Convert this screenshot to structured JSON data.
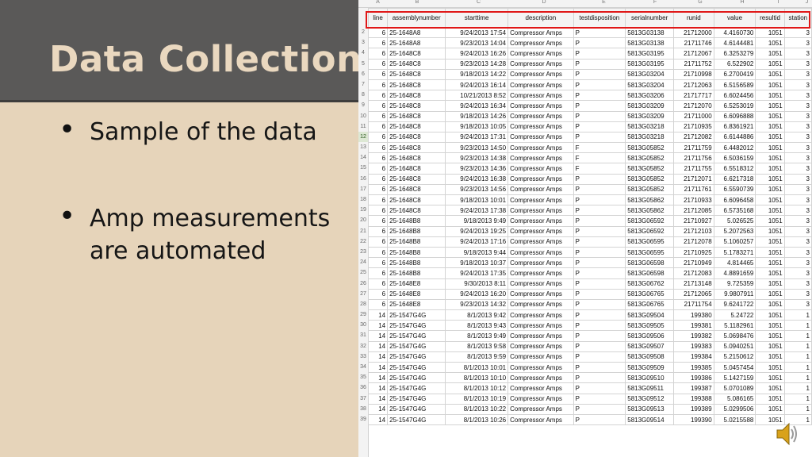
{
  "slide": {
    "title": "Data Collection",
    "bullets": [
      "Sample of the data",
      "Amp measurements are automated"
    ]
  },
  "sheet": {
    "column_letters": [
      "A",
      "B",
      "C",
      "D",
      "E",
      "F",
      "G",
      "H",
      "I",
      "J"
    ],
    "headers": [
      "line",
      "assemblynumber",
      "starttime",
      "description",
      "testdisposition",
      "serialnumber",
      "runid",
      "value",
      "resultid",
      "station"
    ],
    "row_numbers": [
      "2",
      "3",
      "4",
      "5",
      "6",
      "7",
      "8",
      "9",
      "10",
      "11",
      "12",
      "13",
      "14",
      "15",
      "16",
      "17",
      "18",
      "19",
      "20",
      "21",
      "22",
      "23",
      "24",
      "25",
      "26",
      "27",
      "28",
      "29",
      "30",
      "31",
      "32",
      "33",
      "34",
      "35",
      "36",
      "37",
      "38",
      "39"
    ],
    "selected_row_number": "12",
    "rows": [
      [
        "6",
        "25-1648A8",
        "9/24/2013 17:54",
        "Compressor Amps",
        "P",
        "5813G03138",
        "21712000",
        "4.4160730",
        "1051",
        "3"
      ],
      [
        "6",
        "25-1648A8",
        "9/23/2013 14:04",
        "Compressor Amps",
        "P",
        "5813G03138",
        "21711746",
        "4.6144481",
        "1051",
        "3"
      ],
      [
        "6",
        "25-1648C8",
        "9/24/2013 16:26",
        "Compressor Amps",
        "P",
        "5813G03195",
        "21712067",
        "6.3253279",
        "1051",
        "3"
      ],
      [
        "6",
        "25-1648C8",
        "9/23/2013 14:28",
        "Compressor Amps",
        "P",
        "5813G03195",
        "21711752",
        "6.522902",
        "1051",
        "3"
      ],
      [
        "6",
        "25-1648C8",
        "9/18/2013 14:22",
        "Compressor Amps",
        "P",
        "5813G03204",
        "21710998",
        "6.2700419",
        "1051",
        "3"
      ],
      [
        "6",
        "25-1648C8",
        "9/24/2013 16:14",
        "Compressor Amps",
        "P",
        "5813G03204",
        "21712063",
        "6.5156589",
        "1051",
        "3"
      ],
      [
        "6",
        "25-1648C8",
        "10/21/2013 8:52",
        "Compressor Amps",
        "P",
        "5813G03206",
        "21717717",
        "6.6024456",
        "1051",
        "3"
      ],
      [
        "6",
        "25-1648C8",
        "9/24/2013 16:34",
        "Compressor Amps",
        "P",
        "5813G03209",
        "21712070",
        "6.5253019",
        "1051",
        "3"
      ],
      [
        "6",
        "25-1648C8",
        "9/18/2013 14:26",
        "Compressor Amps",
        "P",
        "5813G03209",
        "21711000",
        "6.6096888",
        "1051",
        "3"
      ],
      [
        "6",
        "25-1648C8",
        "9/18/2013 10:05",
        "Compressor Amps",
        "P",
        "5813G03218",
        "21710935",
        "6.8361921",
        "1051",
        "3"
      ],
      [
        "6",
        "25-1648C8",
        "9/24/2013 17:31",
        "Compressor Amps",
        "P",
        "5813G03218",
        "21712082",
        "6.6144886",
        "1051",
        "3"
      ],
      [
        "6",
        "25-1648C8",
        "9/23/2013 14:50",
        "Compressor Amps",
        "F",
        "5813G05852",
        "21711759",
        "6.4482012",
        "1051",
        "3"
      ],
      [
        "6",
        "25-1648C8",
        "9/23/2013 14:38",
        "Compressor Amps",
        "F",
        "5813G05852",
        "21711756",
        "6.5036159",
        "1051",
        "3"
      ],
      [
        "6",
        "25-1648C8",
        "9/23/2013 14:36",
        "Compressor Amps",
        "F",
        "5813G05852",
        "21711755",
        "6.5518312",
        "1051",
        "3"
      ],
      [
        "6",
        "25-1648C8",
        "9/24/2013 16:38",
        "Compressor Amps",
        "P",
        "5813G05852",
        "21712071",
        "6.6217318",
        "1051",
        "3"
      ],
      [
        "6",
        "25-1648C8",
        "9/23/2013 14:56",
        "Compressor Amps",
        "P",
        "5813G05852",
        "21711761",
        "6.5590739",
        "1051",
        "3"
      ],
      [
        "6",
        "25-1648C8",
        "9/18/2013 10:01",
        "Compressor Amps",
        "P",
        "5813G05862",
        "21710933",
        "6.6096458",
        "1051",
        "3"
      ],
      [
        "6",
        "25-1648C8",
        "9/24/2013 17:38",
        "Compressor Amps",
        "P",
        "5813G05862",
        "21712085",
        "6.5735168",
        "1051",
        "3"
      ],
      [
        "6",
        "25-1648B8",
        "9/18/2013 9:49",
        "Compressor Amps",
        "P",
        "5813G06592",
        "21710927",
        "5.026525",
        "1051",
        "3"
      ],
      [
        "6",
        "25-1648B8",
        "9/24/2013 19:25",
        "Compressor Amps",
        "P",
        "5813G06592",
        "21712103",
        "5.2072563",
        "1051",
        "3"
      ],
      [
        "6",
        "25-1648B8",
        "9/24/2013 17:16",
        "Compressor Amps",
        "P",
        "5813G06595",
        "21712078",
        "5.1060257",
        "1051",
        "3"
      ],
      [
        "6",
        "25-1648B8",
        "9/18/2013 9:44",
        "Compressor Amps",
        "P",
        "5813G06595",
        "21710925",
        "5.1783271",
        "1051",
        "3"
      ],
      [
        "6",
        "25-1648B8",
        "9/18/2013 10:37",
        "Compressor Amps",
        "P",
        "5813G06598",
        "21710949",
        "4.814465",
        "1051",
        "3"
      ],
      [
        "6",
        "25-1648B8",
        "9/24/2013 17:35",
        "Compressor Amps",
        "P",
        "5813G06598",
        "21712083",
        "4.8891659",
        "1051",
        "3"
      ],
      [
        "6",
        "25-1648E8",
        "9/30/2013 8:11",
        "Compressor Amps",
        "P",
        "5813G06762",
        "21713148",
        "9.725359",
        "1051",
        "3"
      ],
      [
        "6",
        "25-1648E8",
        "9/24/2013 16:20",
        "Compressor Amps",
        "P",
        "5813G06765",
        "21712065",
        "9.9807911",
        "1051",
        "3"
      ],
      [
        "6",
        "25-1648E8",
        "9/23/2013 14:32",
        "Compressor Amps",
        "P",
        "5813G06765",
        "21711754",
        "9.6241722",
        "1051",
        "3"
      ],
      [
        "14",
        "25-1547G4G",
        "8/1/2013 9:42",
        "Compressor Amps",
        "P",
        "5813G09504",
        "199380",
        "5.24722",
        "1051",
        "1"
      ],
      [
        "14",
        "25-1547G4G",
        "8/1/2013 9:43",
        "Compressor Amps",
        "P",
        "5813G09505",
        "199381",
        "5.1182961",
        "1051",
        "1"
      ],
      [
        "14",
        "25-1547G4G",
        "8/1/2013 9:49",
        "Compressor Amps",
        "P",
        "5813G09506",
        "199382",
        "5.0698476",
        "1051",
        "1"
      ],
      [
        "14",
        "25-1547G4G",
        "8/1/2013 9:58",
        "Compressor Amps",
        "P",
        "5813G09507",
        "199383",
        "5.0940251",
        "1051",
        "1"
      ],
      [
        "14",
        "25-1547G4G",
        "8/1/2013 9:59",
        "Compressor Amps",
        "P",
        "5813G09508",
        "199384",
        "5.2150612",
        "1051",
        "1"
      ],
      [
        "14",
        "25-1547G4G",
        "8/1/2013 10:01",
        "Compressor Amps",
        "P",
        "5813G09509",
        "199385",
        "5.0457454",
        "1051",
        "1"
      ],
      [
        "14",
        "25-1547G4G",
        "8/1/2013 10:10",
        "Compressor Amps",
        "P",
        "5813G09510",
        "199386",
        "5.1427159",
        "1051",
        "1"
      ],
      [
        "14",
        "25-1547G4G",
        "8/1/2013 10:12",
        "Compressor Amps",
        "P",
        "5813G09511",
        "199387",
        "5.0701089",
        "1051",
        "1"
      ],
      [
        "14",
        "25-1547G4G",
        "8/1/2013 10:19",
        "Compressor Amps",
        "P",
        "5813G09512",
        "199388",
        "5.086165",
        "1051",
        "1"
      ],
      [
        "14",
        "25-1547G4G",
        "8/1/2013 10:22",
        "Compressor Amps",
        "P",
        "5813G09513",
        "199389",
        "5.0299506",
        "1051",
        "1"
      ],
      [
        "14",
        "25-1547G4G",
        "8/1/2013 10:26",
        "Compressor Amps",
        "P",
        "5813G09514",
        "199390",
        "5.0215588",
        "1051",
        "1"
      ]
    ]
  },
  "icons": {
    "speaker": "speaker-icon"
  },
  "colors": {
    "accent_red": "#e01818",
    "title_bar": "#5a5958",
    "slide_bg": "#e6d4ba",
    "title_text": "#ead8bf"
  }
}
